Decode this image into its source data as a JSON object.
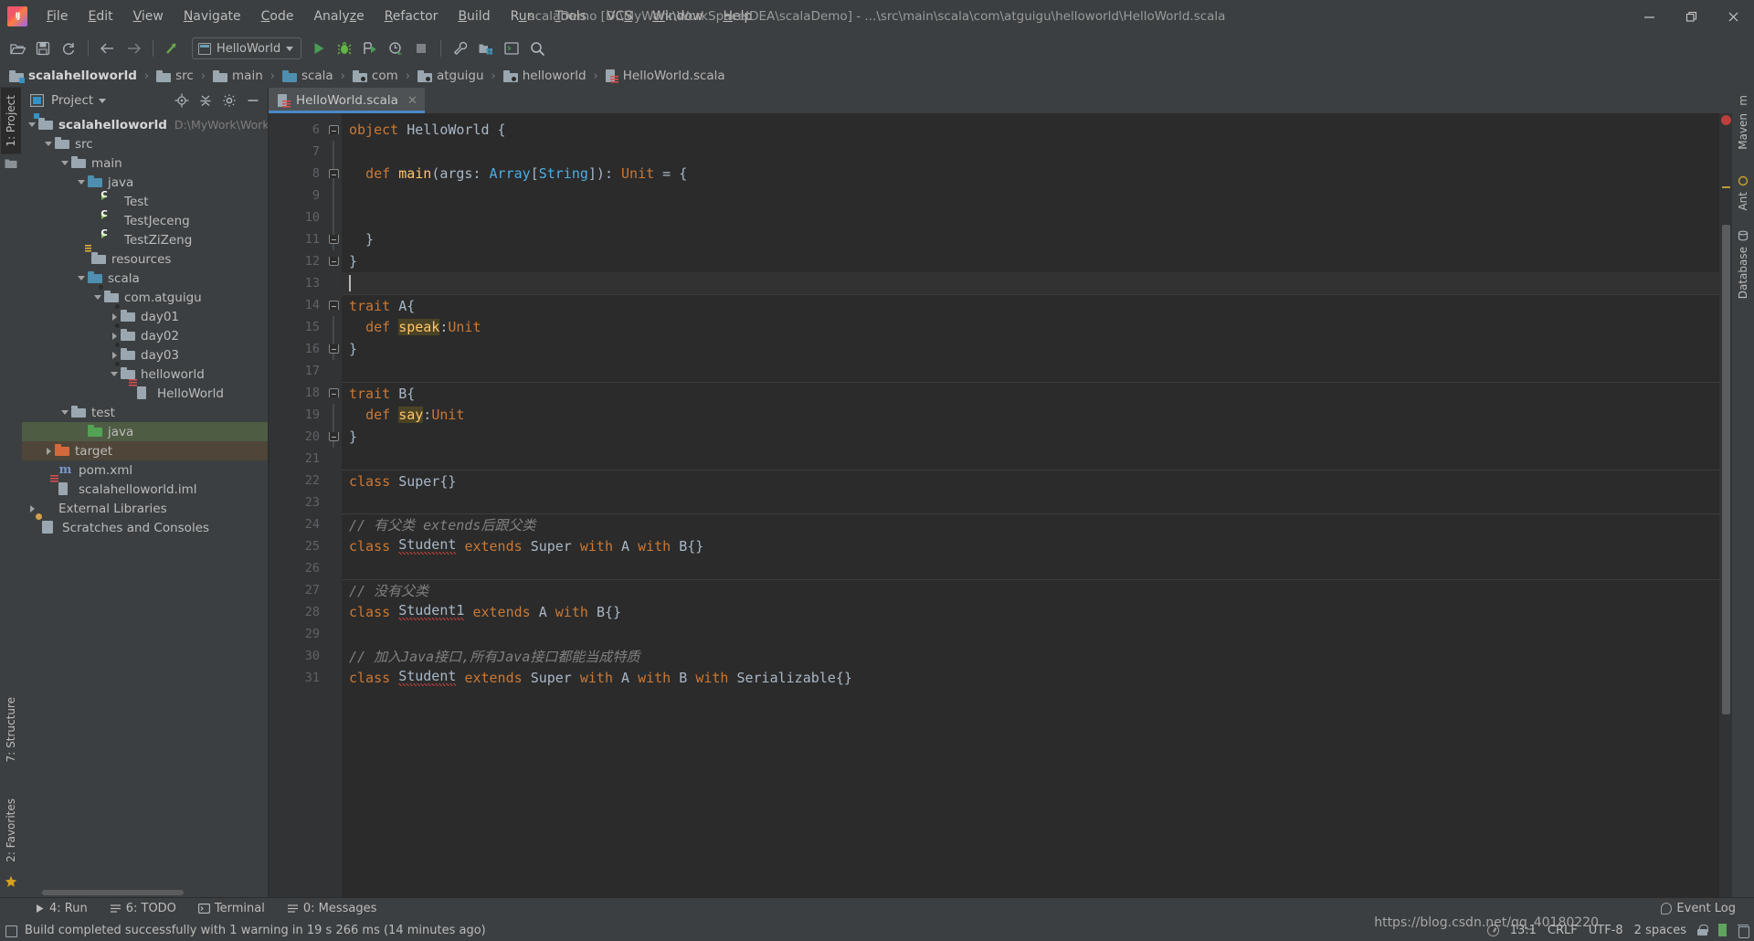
{
  "window": {
    "title": "scalaDemo [D:\\MyWork\\WorkSpaceIDEA\\scalaDemo] - ...\\src\\main\\scala\\com\\atguigu\\helloworld\\HelloWorld.scala",
    "minimize": "—",
    "maximize": "❐",
    "close": "✕"
  },
  "menubar": {
    "items": [
      {
        "label": "File"
      },
      {
        "label": "Edit"
      },
      {
        "label": "View"
      },
      {
        "label": "Navigate"
      },
      {
        "label": "Code"
      },
      {
        "label": "Analyze"
      },
      {
        "label": "Refactor"
      },
      {
        "label": "Build"
      },
      {
        "label": "Run"
      },
      {
        "label": "Tools"
      },
      {
        "label": "VCS"
      },
      {
        "label": "Window"
      },
      {
        "label": "Help"
      }
    ]
  },
  "toolbar": {
    "run_config": "HelloWorld",
    "icons": [
      "open-folder-icon",
      "save-all-icon",
      "sync-icon",
      "back-arrow-icon",
      "forward-arrow-icon",
      "update-project-icon"
    ],
    "run_icons": [
      "run-icon",
      "debug-icon",
      "run-coverage-icon",
      "profile-icon",
      "stop-icon"
    ],
    "right_icons": [
      "settings-wrench-icon",
      "project-structure-icon",
      "terminal-icon",
      "search-everywhere-icon"
    ]
  },
  "breadcrumb": {
    "items": [
      {
        "label": "scalahelloworld",
        "icon": "module-folder-icon",
        "bold": true
      },
      {
        "label": "src",
        "icon": "folder-icon",
        "bold": false
      },
      {
        "label": "main",
        "icon": "folder-icon",
        "bold": false
      },
      {
        "label": "scala",
        "icon": "source-folder-icon",
        "bold": false
      },
      {
        "label": "com",
        "icon": "package-icon",
        "bold": false
      },
      {
        "label": "atguigu",
        "icon": "package-icon",
        "bold": false
      },
      {
        "label": "helloworld",
        "icon": "package-icon",
        "bold": false
      },
      {
        "label": "HelloWorld.scala",
        "icon": "scala-file-icon",
        "bold": false
      }
    ],
    "separator": "›"
  },
  "left_strip": {
    "project_tab": "1: Project",
    "structure_tab": "7: Structure",
    "favorites_tab": "2: Favorites"
  },
  "right_strip": {
    "tabs": [
      "m Maven",
      "Ant",
      "Database"
    ]
  },
  "project_panel": {
    "title": "Project",
    "locate_icon": "locate-icon",
    "collapse_icon": "collapse-all-icon",
    "settings_icon": "gear-icon",
    "hide_icon": "hide-icon",
    "tree": [
      {
        "label": "scalahelloworld",
        "path": "D:\\MyWork\\WorkSpac",
        "indent": 0,
        "arrow": "down",
        "icon": "module-folder-icon",
        "bold": true,
        "state": "none"
      },
      {
        "label": "src",
        "path": "",
        "indent": 1,
        "arrow": "down",
        "icon": "folder-grey-icon",
        "bold": false,
        "state": "none"
      },
      {
        "label": "main",
        "path": "",
        "indent": 2,
        "arrow": "down",
        "icon": "folder-grey-icon",
        "bold": false,
        "state": "none"
      },
      {
        "label": "java",
        "path": "",
        "indent": 3,
        "arrow": "down",
        "icon": "folder-blue-icon",
        "bold": false,
        "state": "none"
      },
      {
        "label": "Test",
        "path": "",
        "indent": 4,
        "arrow": "none",
        "icon": "scala-class-icon",
        "bold": false,
        "state": "none"
      },
      {
        "label": "TestJeceng",
        "path": "",
        "indent": 4,
        "arrow": "none",
        "icon": "scala-class-icon",
        "bold": false,
        "state": "none"
      },
      {
        "label": "TestZiZeng",
        "path": "",
        "indent": 4,
        "arrow": "none",
        "icon": "scala-class-icon",
        "bold": false,
        "state": "none"
      },
      {
        "label": "resources",
        "path": "",
        "indent": 3,
        "arrow": "none",
        "icon": "resources-folder-icon",
        "bold": false,
        "state": "none"
      },
      {
        "label": "scala",
        "path": "",
        "indent": 3,
        "arrow": "down",
        "icon": "folder-blue-icon",
        "bold": false,
        "state": "none"
      },
      {
        "label": "com.atguigu",
        "path": "",
        "indent": 4,
        "arrow": "down",
        "icon": "package-icon",
        "bold": false,
        "state": "none"
      },
      {
        "label": "day01",
        "path": "",
        "indent": 5,
        "arrow": "right",
        "icon": "package-icon",
        "bold": false,
        "state": "none"
      },
      {
        "label": "day02",
        "path": "",
        "indent": 5,
        "arrow": "right",
        "icon": "package-icon",
        "bold": false,
        "state": "none"
      },
      {
        "label": "day03",
        "path": "",
        "indent": 5,
        "arrow": "right",
        "icon": "package-icon",
        "bold": false,
        "state": "none"
      },
      {
        "label": "helloworld",
        "path": "",
        "indent": 5,
        "arrow": "down",
        "icon": "package-icon",
        "bold": false,
        "state": "none"
      },
      {
        "label": "HelloWorld",
        "path": "",
        "indent": 6,
        "arrow": "none",
        "icon": "scala-file-icon",
        "bold": false,
        "state": "none"
      },
      {
        "label": "test",
        "path": "",
        "indent": 2,
        "arrow": "down",
        "icon": "folder-grey-icon",
        "bold": false,
        "state": "none"
      },
      {
        "label": "java",
        "path": "",
        "indent": 3,
        "arrow": "none",
        "icon": "folder-green-icon",
        "bold": false,
        "state": "selected-green"
      },
      {
        "label": "target",
        "path": "",
        "indent": 1,
        "arrow": "right",
        "icon": "folder-orange-icon",
        "bold": false,
        "state": "selected-brown"
      },
      {
        "label": "pom.xml",
        "path": "",
        "indent": 1,
        "arrow": "none",
        "icon": "maven-icon",
        "bold": false,
        "state": "none"
      },
      {
        "label": "scalahelloworld.iml",
        "path": "",
        "indent": 1,
        "arrow": "none",
        "icon": "scala-file-icon",
        "bold": false,
        "state": "none"
      },
      {
        "label": "External Libraries",
        "path": "",
        "indent": 0,
        "arrow": "right",
        "icon": "libraries-icon",
        "bold": false,
        "state": "none"
      },
      {
        "label": "Scratches and Consoles",
        "path": "",
        "indent": 0,
        "arrow": "none",
        "icon": "scratches-icon",
        "bold": false,
        "state": "none"
      }
    ]
  },
  "editor": {
    "tab": {
      "label": "HelloWorld.scala",
      "icon": "scala-file-icon",
      "close": "✕"
    },
    "first_line_number": 6,
    "lines": [
      {
        "n": 6,
        "gutter": "run-icon",
        "fold": "open",
        "indent": 0,
        "tokens": [
          {
            "t": "object",
            "c": "kw"
          },
          {
            "t": " ",
            "c": "plain"
          },
          {
            "t": "HelloWorld",
            "c": "typ"
          },
          {
            "t": " {",
            "c": "plain"
          }
        ]
      },
      {
        "n": 7,
        "gutter": "",
        "fold": "bar",
        "indent": 0,
        "tokens": []
      },
      {
        "n": 8,
        "gutter": "run-icon",
        "fold": "open",
        "indent": 1,
        "tokens": [
          {
            "t": "def",
            "c": "kw"
          },
          {
            "t": " ",
            "c": "plain"
          },
          {
            "t": "main",
            "c": "fn"
          },
          {
            "t": "(args: ",
            "c": "plain"
          },
          {
            "t": "Array",
            "c": "gtyp"
          },
          {
            "t": "[",
            "c": "plain"
          },
          {
            "t": "String",
            "c": "gtyp"
          },
          {
            "t": "]): ",
            "c": "plain"
          },
          {
            "t": "Unit",
            "c": "kw"
          },
          {
            "t": " = {",
            "c": "plain"
          }
        ]
      },
      {
        "n": 9,
        "gutter": "",
        "fold": "bar",
        "indent": 0,
        "tokens": []
      },
      {
        "n": 10,
        "gutter": "",
        "fold": "bar",
        "indent": 0,
        "tokens": []
      },
      {
        "n": 11,
        "gutter": "",
        "fold": "close",
        "indent": 1,
        "tokens": [
          {
            "t": "}",
            "c": "plain"
          }
        ]
      },
      {
        "n": 12,
        "gutter": "",
        "fold": "close",
        "indent": 0,
        "tokens": [
          {
            "t": "}",
            "c": "plain"
          }
        ]
      },
      {
        "n": 13,
        "gutter": "",
        "fold": "none",
        "indent": 0,
        "caret": true,
        "tokens": []
      },
      {
        "n": 14,
        "gutter": "override-green",
        "fold": "open",
        "indent": 0,
        "sep": true,
        "tokens": [
          {
            "t": "trait",
            "c": "kw"
          },
          {
            "t": " ",
            "c": "plain"
          },
          {
            "t": "A{",
            "c": "typ"
          }
        ]
      },
      {
        "n": 15,
        "gutter": "",
        "fold": "bar",
        "indent": 1,
        "tokens": [
          {
            "t": "def",
            "c": "kw"
          },
          {
            "t": " ",
            "c": "plain"
          },
          {
            "t": "speak",
            "c": "fn hl"
          },
          {
            "t": ":",
            "c": "plain"
          },
          {
            "t": "Unit",
            "c": "kw"
          }
        ]
      },
      {
        "n": 16,
        "gutter": "",
        "fold": "close",
        "indent": 0,
        "tokens": [
          {
            "t": "}",
            "c": "plain"
          }
        ]
      },
      {
        "n": 17,
        "gutter": "",
        "fold": "none",
        "indent": 0,
        "tokens": []
      },
      {
        "n": 18,
        "gutter": "override-green",
        "fold": "open",
        "indent": 0,
        "sep": true,
        "tokens": [
          {
            "t": "trait",
            "c": "kw"
          },
          {
            "t": " ",
            "c": "plain"
          },
          {
            "t": "B{",
            "c": "typ"
          }
        ]
      },
      {
        "n": 19,
        "gutter": "",
        "fold": "bar",
        "indent": 1,
        "tokens": [
          {
            "t": "def",
            "c": "kw"
          },
          {
            "t": " ",
            "c": "plain"
          },
          {
            "t": "say",
            "c": "fn hl"
          },
          {
            "t": ":",
            "c": "plain"
          },
          {
            "t": "Unit",
            "c": "kw"
          }
        ]
      },
      {
        "n": 20,
        "gutter": "",
        "fold": "close",
        "indent": 0,
        "tokens": [
          {
            "t": "}",
            "c": "plain"
          }
        ]
      },
      {
        "n": 21,
        "gutter": "",
        "fold": "none",
        "indent": 0,
        "tokens": []
      },
      {
        "n": 22,
        "gutter": "override-blue",
        "fold": "none",
        "indent": 0,
        "sep": true,
        "tokens": [
          {
            "t": "class",
            "c": "kw"
          },
          {
            "t": " ",
            "c": "plain"
          },
          {
            "t": "Super",
            "c": "typ"
          },
          {
            "t": "{}",
            "c": "plain"
          }
        ]
      },
      {
        "n": 23,
        "gutter": "",
        "fold": "none",
        "indent": 0,
        "tokens": []
      },
      {
        "n": 24,
        "gutter": "",
        "fold": "none",
        "indent": 0,
        "sep": true,
        "tokens": [
          {
            "t": "// 有父类 extends后跟父类",
            "c": "cmt"
          }
        ]
      },
      {
        "n": 25,
        "gutter": "",
        "fold": "none",
        "indent": 0,
        "tokens": [
          {
            "t": "class",
            "c": "kw"
          },
          {
            "t": " ",
            "c": "plain"
          },
          {
            "t": "Student",
            "c": "typ wavy"
          },
          {
            "t": " ",
            "c": "plain"
          },
          {
            "t": "extends",
            "c": "kw"
          },
          {
            "t": " ",
            "c": "plain"
          },
          {
            "t": "Super",
            "c": "typ"
          },
          {
            "t": " ",
            "c": "plain"
          },
          {
            "t": "with",
            "c": "kw"
          },
          {
            "t": " ",
            "c": "plain"
          },
          {
            "t": "A",
            "c": "typ"
          },
          {
            "t": " ",
            "c": "plain"
          },
          {
            "t": "with",
            "c": "kw"
          },
          {
            "t": " ",
            "c": "plain"
          },
          {
            "t": "B{}",
            "c": "typ"
          }
        ]
      },
      {
        "n": 26,
        "gutter": "",
        "fold": "none",
        "indent": 0,
        "tokens": []
      },
      {
        "n": 27,
        "gutter": "",
        "fold": "none",
        "indent": 0,
        "sep": true,
        "tokens": [
          {
            "t": "// 没有父类",
            "c": "cmt"
          }
        ]
      },
      {
        "n": 28,
        "gutter": "",
        "fold": "none",
        "indent": 0,
        "tokens": [
          {
            "t": "class",
            "c": "kw"
          },
          {
            "t": " ",
            "c": "plain"
          },
          {
            "t": "Student1",
            "c": "typ wavy"
          },
          {
            "t": " ",
            "c": "plain"
          },
          {
            "t": "extends",
            "c": "kw"
          },
          {
            "t": " ",
            "c": "plain"
          },
          {
            "t": "A",
            "c": "typ"
          },
          {
            "t": " ",
            "c": "plain"
          },
          {
            "t": "with",
            "c": "kw"
          },
          {
            "t": " ",
            "c": "plain"
          },
          {
            "t": "B{}",
            "c": "typ"
          }
        ]
      },
      {
        "n": 29,
        "gutter": "",
        "fold": "none",
        "indent": 0,
        "tokens": []
      },
      {
        "n": 30,
        "gutter": "",
        "fold": "none",
        "indent": 0,
        "tokens": [
          {
            "t": "// 加入Java接口,所有Java接口都能当成特质",
            "c": "cmt"
          }
        ]
      },
      {
        "n": 31,
        "gutter": "",
        "fold": "none",
        "indent": 0,
        "tokens": [
          {
            "t": "class",
            "c": "kw"
          },
          {
            "t": " ",
            "c": "plain"
          },
          {
            "t": "Student",
            "c": "typ wavy"
          },
          {
            "t": " ",
            "c": "plain"
          },
          {
            "t": "extends",
            "c": "kw"
          },
          {
            "t": " ",
            "c": "plain"
          },
          {
            "t": "Super",
            "c": "typ"
          },
          {
            "t": " ",
            "c": "plain"
          },
          {
            "t": "with",
            "c": "kw"
          },
          {
            "t": " ",
            "c": "plain"
          },
          {
            "t": "A",
            "c": "typ"
          },
          {
            "t": " ",
            "c": "plain"
          },
          {
            "t": "with",
            "c": "kw"
          },
          {
            "t": " ",
            "c": "plain"
          },
          {
            "t": "B",
            "c": "typ"
          },
          {
            "t": " ",
            "c": "plain"
          },
          {
            "t": "with",
            "c": "kw"
          },
          {
            "t": " ",
            "c": "plain"
          },
          {
            "t": "Serializable{}",
            "c": "typ"
          }
        ]
      }
    ]
  },
  "toolwindow_bar": {
    "items": [
      {
        "label": "4: Run",
        "icon": "run-icon"
      },
      {
        "label": "6: TODO",
        "icon": "todo-icon"
      },
      {
        "label": "Terminal",
        "icon": "terminal-icon"
      },
      {
        "label": "0: Messages",
        "icon": "messages-icon"
      }
    ]
  },
  "statusbar": {
    "message": "Build completed successfully with 1 warning in 19 s 266 ms (14 minutes ago)",
    "event_log": "Event Log",
    "caret_position": "13:1",
    "line_separator": "CRLF",
    "encoding": "UTF-8",
    "indent": "2 spaces",
    "watermark": "https://blog.csdn.net/qq_40180220"
  },
  "colors": {
    "accent": "#4a88c7",
    "keyword": "#cc7832",
    "function": "#ffc66d",
    "type": "#a9b7c6",
    "generic": "#4eade5",
    "comment": "#808080",
    "error": "#bc3f3c",
    "editor_bg": "#2b2b2b",
    "chrome_bg": "#3c3f41",
    "selection_green": "#4e5c43"
  }
}
